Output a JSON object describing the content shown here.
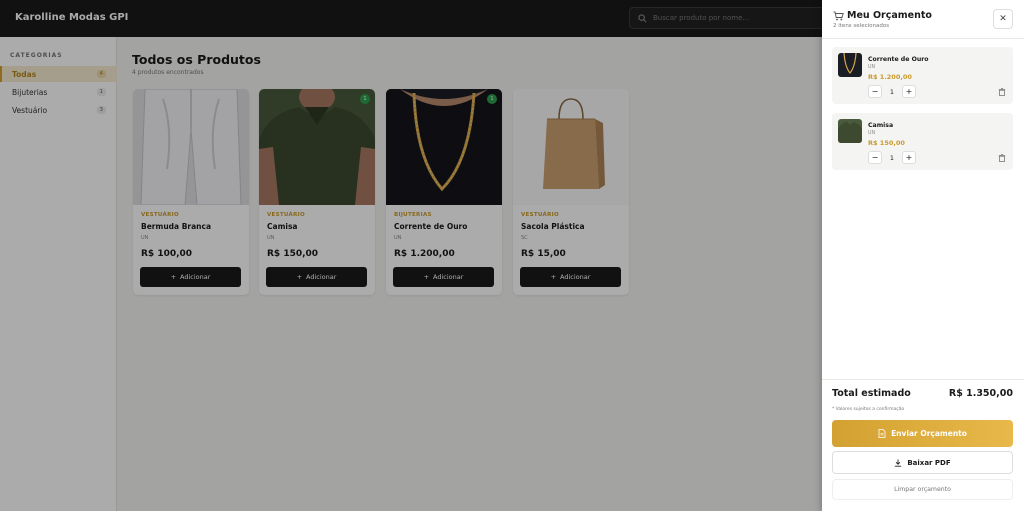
{
  "header": {
    "brand": "Karolline Modas GPI",
    "search_placeholder": "Buscar produto por nome..."
  },
  "sidebar": {
    "title": "CATEGORIAS",
    "items": [
      {
        "label": "Todas",
        "count": "4",
        "active": true
      },
      {
        "label": "Bijuterias",
        "count": "1",
        "active": false
      },
      {
        "label": "Vestuário",
        "count": "3",
        "active": false
      }
    ]
  },
  "main": {
    "title": "Todos os Produtos",
    "subtitle": "4 produtos encontrados",
    "products": [
      {
        "category": "VESTUÁRIO",
        "name": "Bermuda Branca",
        "unit": "UN",
        "price": "R$ 100,00",
        "button": "Adicionar",
        "badge": "",
        "image_icon": "white-shorts-photo"
      },
      {
        "category": "VESTUÁRIO",
        "name": "Camisa",
        "unit": "UN",
        "price": "R$ 150,00",
        "button": "Adicionar",
        "badge": "1",
        "image_icon": "green-polo-shirt-photo"
      },
      {
        "category": "BIJUTERIAS",
        "name": "Corrente de Ouro",
        "unit": "UN",
        "price": "R$ 1.200,00",
        "button": "Adicionar",
        "badge": "1",
        "image_icon": "gold-chain-photo"
      },
      {
        "category": "VESTUÁRIO",
        "name": "Sacola Plástica",
        "unit": "SC",
        "price": "R$ 15,00",
        "button": "Adicionar",
        "badge": "",
        "image_icon": "paper-bag-photo"
      }
    ]
  },
  "cart": {
    "title": "Meu Orçamento",
    "subtitle": "2 itens selecionados",
    "items": [
      {
        "name": "Corrente de Ouro",
        "unit": "UN",
        "price": "R$ 1.200,00",
        "qty": "1"
      },
      {
        "name": "Camisa",
        "unit": "UN",
        "price": "R$ 150,00",
        "qty": "1"
      }
    ],
    "total_label": "Total estimado",
    "total_value": "R$ 1.350,00",
    "note": "* Valores sujeitos a confirmação",
    "send_label": "Enviar Orçamento",
    "pdf_label": "Baixar PDF",
    "clear_label": "Limpar orçamento"
  },
  "colors": {
    "accent": "#d4a12b",
    "header_bg": "#1a1a1a",
    "badge": "#2e9e4e"
  }
}
